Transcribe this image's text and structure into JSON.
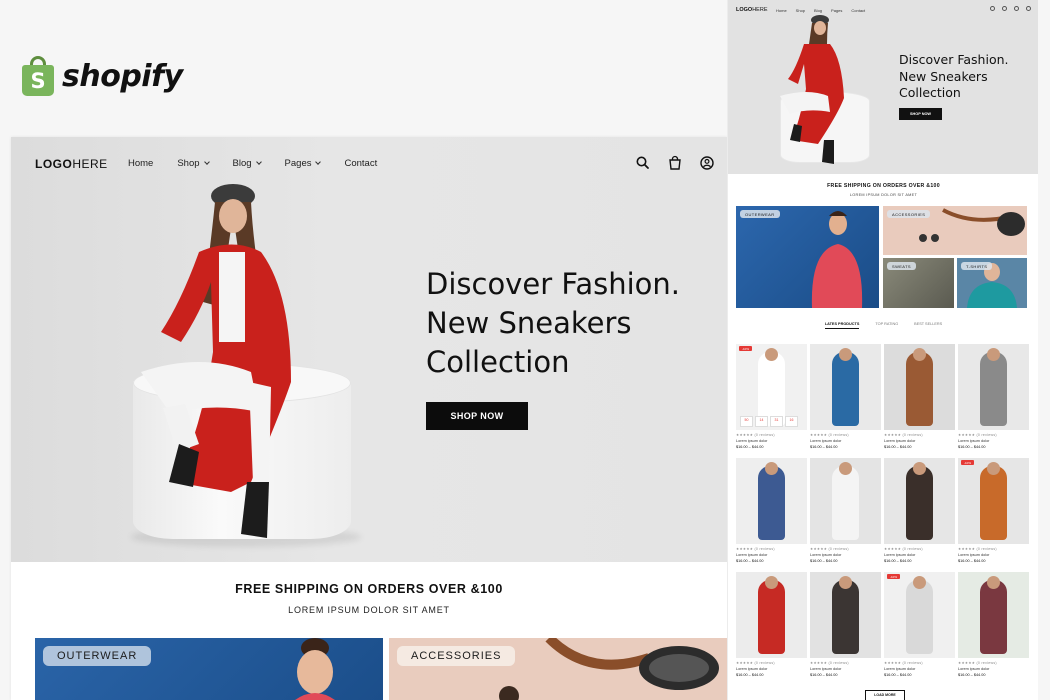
{
  "brand": {
    "wordmark": "shopify",
    "bag_letter": "S",
    "bag_color": "#7ab55c"
  },
  "site": {
    "logo_bold": "LOGO",
    "logo_light": "HERE",
    "nav": [
      {
        "label": "Home",
        "dropdown": false
      },
      {
        "label": "Shop",
        "dropdown": true
      },
      {
        "label": "Blog",
        "dropdown": true
      },
      {
        "label": "Pages",
        "dropdown": true
      },
      {
        "label": "Contact",
        "dropdown": false
      }
    ],
    "icons": [
      "search-icon",
      "cart-icon",
      "account-icon"
    ]
  },
  "hero": {
    "title_lines": [
      "Discover Fashion.",
      "New Sneakers",
      "Collection"
    ],
    "cta": "SHOP NOW",
    "bg": "#e2e2e2",
    "accent": "#c6201c"
  },
  "shipping": {
    "title": "FREE SHIPPING ON ORDERS OVER &100",
    "subtitle": "LOREM IPSUM DOLOR SIT AMET"
  },
  "categories": [
    {
      "label": "OUTERWEAR"
    },
    {
      "label": "ACCESSORIES"
    },
    {
      "label": "SWEATS"
    },
    {
      "label": "T-SHIRTS"
    }
  ],
  "mobile": {
    "tabs": [
      {
        "label": "LATES PRODUCTS",
        "active": true
      },
      {
        "label": "TOP RATING",
        "active": false
      },
      {
        "label": "BEST SELLERS",
        "active": false
      }
    ],
    "products": [
      {
        "badge": "-10%",
        "rating": "★★★★★ (0 reviews)",
        "name": "Lorem ipsum dolor",
        "price": "$16.00 – $44.00",
        "color": "#f1f1f1",
        "fig": "#ffffff",
        "timer": [
          "50",
          "14",
          "31",
          "16"
        ]
      },
      {
        "badge": "",
        "rating": "★★★★★ (0 reviews)",
        "name": "Lorem ipsum dolor",
        "price": "$16.00 – $44.00",
        "color": "#e9e9e9",
        "fig": "#2a6aa4"
      },
      {
        "badge": "",
        "rating": "★★★★★ (0 reviews)",
        "name": "Lorem ipsum dolor",
        "price": "$16.00 – $44.00",
        "color": "#dcdcdc",
        "fig": "#9a5a34"
      },
      {
        "badge": "",
        "rating": "★★★★★ (0 reviews)",
        "name": "Lorem ipsum dolor",
        "price": "$16.00 – $44.00",
        "color": "#e8e8e8",
        "fig": "#8a8a8a"
      },
      {
        "badge": "",
        "rating": "★★★★★ (0 reviews)",
        "name": "Lorem ipsum dolor",
        "price": "$16.00 – $44.00",
        "color": "#eeeeee",
        "fig": "#3d5a92"
      },
      {
        "badge": "",
        "rating": "★★★★★ (0 reviews)",
        "name": "Lorem ipsum dolor",
        "price": "$16.00 – $44.00",
        "color": "#e4e4e4",
        "fig": "#f4f4f4"
      },
      {
        "badge": "",
        "rating": "★★★★★ (0 reviews)",
        "name": "Lorem ipsum dolor",
        "price": "$16.00 – $44.00",
        "color": "#e6e6e6",
        "fig": "#3a2f2a"
      },
      {
        "badge": "-10%",
        "rating": "★★★★★ (0 reviews)",
        "name": "Lorem ipsum dolor",
        "price": "$16.00 – $44.00",
        "color": "#e6e6e6",
        "fig": "#c86a2a"
      },
      {
        "badge": "",
        "rating": "★★★★★ (0 reviews)",
        "name": "Lorem ipsum dolor",
        "price": "$16.00 – $44.00",
        "color": "#ececec",
        "fig": "#c62a24"
      },
      {
        "badge": "",
        "rating": "★★★★★ (0 reviews)",
        "name": "Lorem ipsum dolor",
        "price": "$16.00 – $44.00",
        "color": "#e2e2e2",
        "fig": "#3b3533"
      },
      {
        "badge": "-10%",
        "rating": "★★★★★ (0 reviews)",
        "name": "Lorem ipsum dolor",
        "price": "$16.00 – $44.00",
        "color": "#f0f0f0",
        "fig": "#d9d9d9"
      },
      {
        "badge": "",
        "rating": "★★★★★ (0 reviews)",
        "name": "Lorem ipsum dolor",
        "price": "$16.00 – $44.00",
        "color": "#e5ebe4",
        "fig": "#7a3840"
      }
    ],
    "load_more": "LOAD MORE"
  }
}
